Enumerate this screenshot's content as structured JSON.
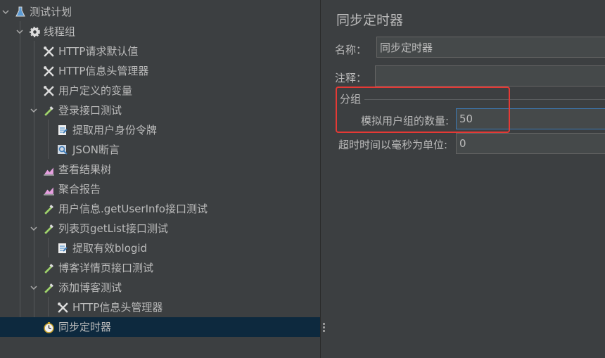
{
  "tree": {
    "items": [
      {
        "label": "测试计划",
        "icon": "flask-icon"
      },
      {
        "label": "线程组",
        "icon": "gear-icon"
      },
      {
        "label": "HTTP请求默认值",
        "icon": "wrench-icon"
      },
      {
        "label": "HTTP信息头管理器",
        "icon": "wrench-icon"
      },
      {
        "label": "用户定义的变量",
        "icon": "wrench-icon"
      },
      {
        "label": "登录接口测试",
        "icon": "pipette-icon"
      },
      {
        "label": "提取用户身份令牌",
        "icon": "extractor-icon"
      },
      {
        "label": "JSON断言",
        "icon": "magnifier-icon"
      },
      {
        "label": "查看结果树",
        "icon": "chart-icon"
      },
      {
        "label": "聚合报告",
        "icon": "chart-icon"
      },
      {
        "label": "用户信息.getUserInfo接口测试",
        "icon": "pipette-icon"
      },
      {
        "label": "列表页getList接口测试",
        "icon": "pipette-icon"
      },
      {
        "label": "提取有效blogid",
        "icon": "extractor-icon"
      },
      {
        "label": "博客详情页接口测试",
        "icon": "pipette-icon"
      },
      {
        "label": "添加博客测试",
        "icon": "pipette-icon"
      },
      {
        "label": "HTTP信息头管理器",
        "icon": "wrench-icon"
      },
      {
        "label": "同步定时器",
        "icon": "timer-icon"
      }
    ],
    "selected_label": "同步定时器"
  },
  "form": {
    "title": "同步定时器",
    "name_label": "名称：",
    "name_value": "同步定时器",
    "comment_label": "注释：",
    "comment_value": "",
    "group_title": "分组",
    "users_label": "模拟用户组的数量:",
    "users_value": "50",
    "timeout_label": "超时时间以毫秒为单位:",
    "timeout_value": "0"
  },
  "colors": {
    "background": "#3c3f41",
    "selection": "#0d293e",
    "text": "#bbbbbb",
    "highlight_box": "#e53935",
    "focus_border": "#3d7ab5"
  }
}
